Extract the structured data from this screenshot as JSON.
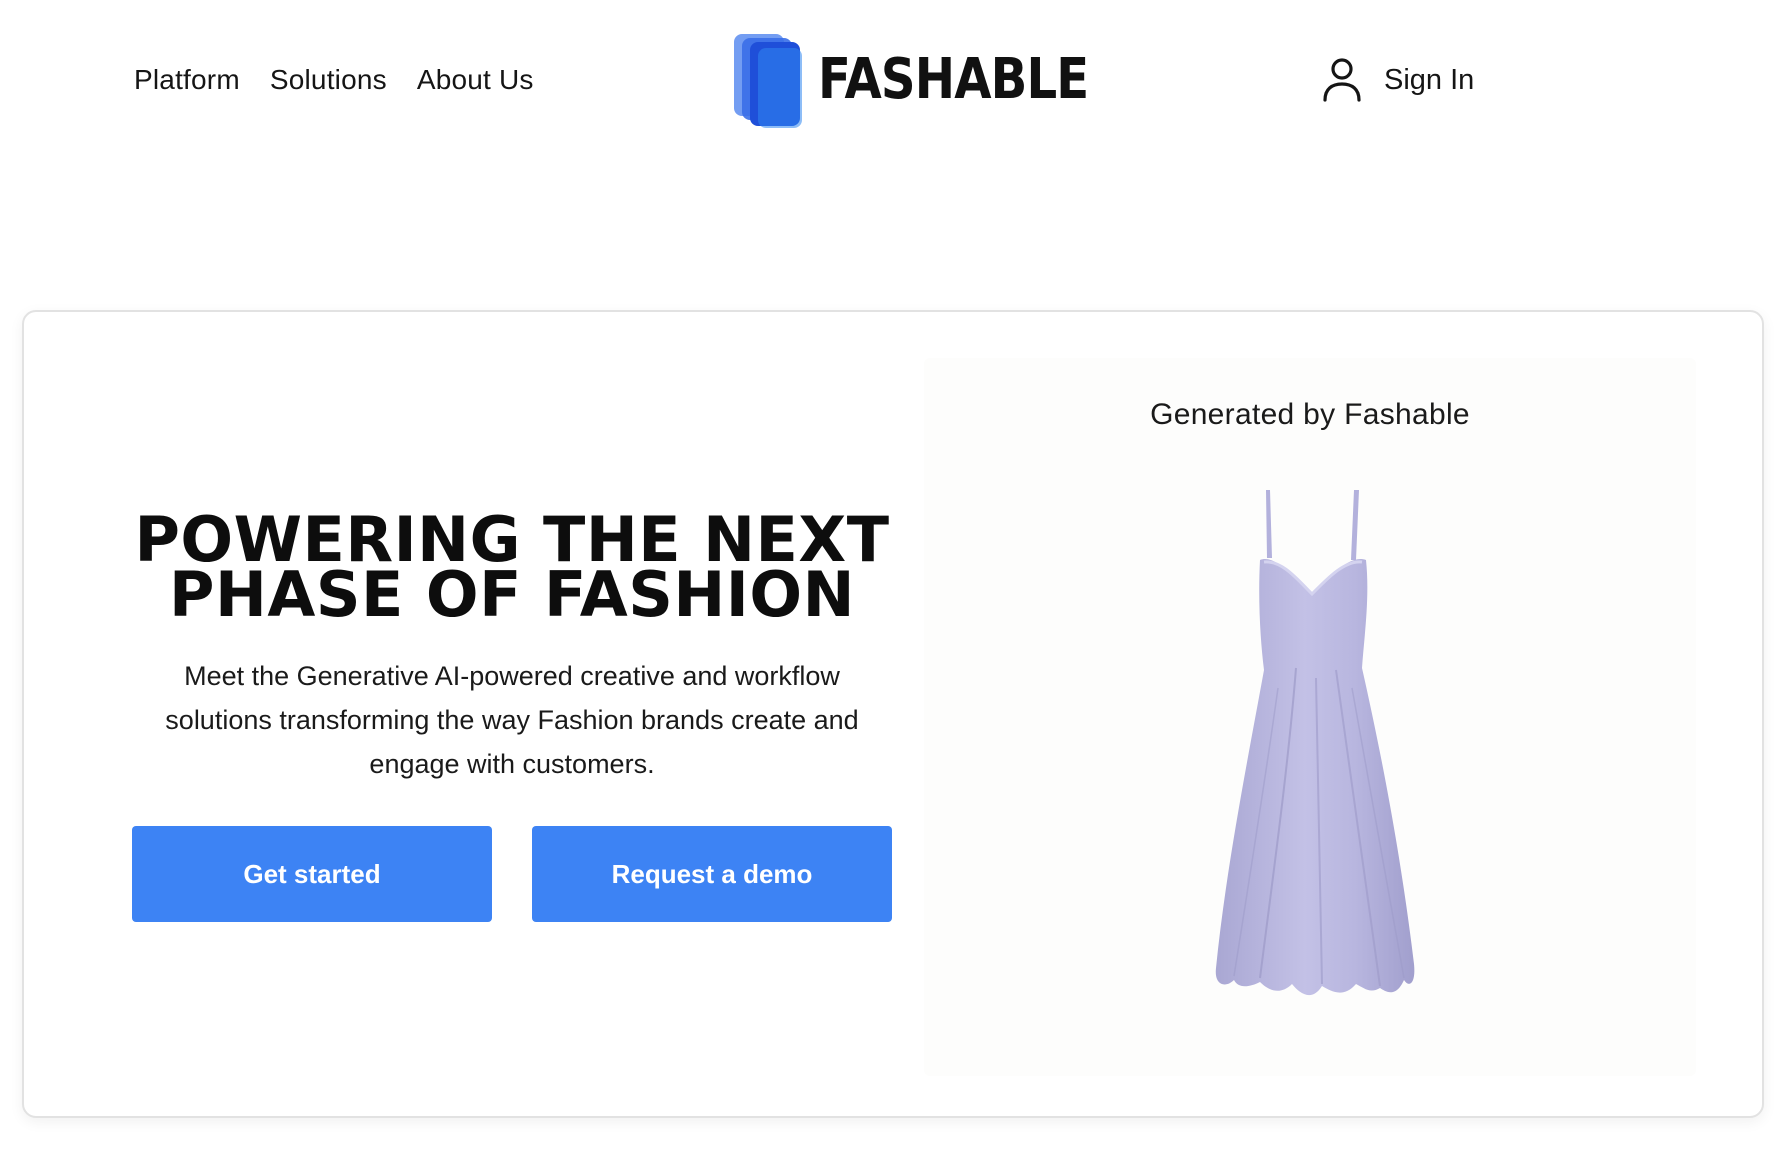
{
  "header": {
    "nav": [
      {
        "label": "Platform"
      },
      {
        "label": "Solutions"
      },
      {
        "label": "About Us"
      }
    ],
    "brand": {
      "name": "FASHABLE",
      "logo_icon": "stacked-layers-logo-icon",
      "logo_colors": [
        "#5b8cf0",
        "#3a6fe8",
        "#1f4fd9",
        "#2f86f0"
      ]
    },
    "signin": {
      "icon": "user-icon",
      "label": "Sign In"
    }
  },
  "hero": {
    "title_line1": "POWERING THE NEXT",
    "title_line2": "PHASE OF FASHION",
    "description": "Meet the Generative AI-powered creative and workflow solutions transforming the way Fashion brands create and engage with customers.",
    "buttons": {
      "primary": "Get started",
      "secondary": "Request a demo"
    },
    "button_color": "#3d83f4",
    "image": {
      "caption": "Generated by Fashable",
      "subject": "lavender-slip-dress",
      "dress_color": "#bdbbe0"
    }
  }
}
